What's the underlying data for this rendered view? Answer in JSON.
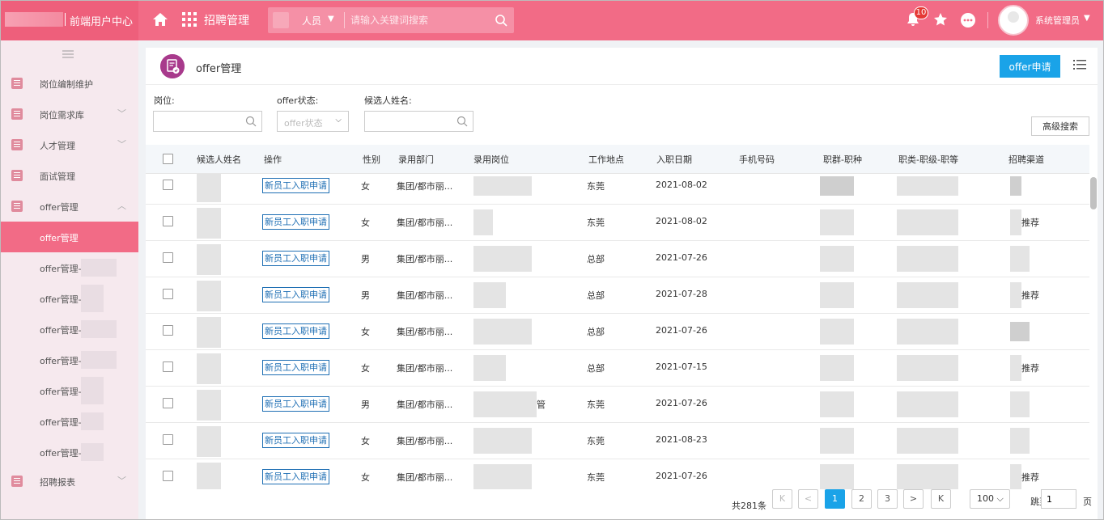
{
  "topbar": {
    "app_name": "前端用户中心",
    "module_title": "招聘管理",
    "search_category": "人员",
    "search_placeholder": "请输入关键词搜索",
    "notification_count": "10",
    "user_name": "系统管理员",
    "accent_color": "#f26b86"
  },
  "sidebar": {
    "items": [
      {
        "label": "岗位编制维护",
        "icon": "document-icon"
      },
      {
        "label": "岗位需求库",
        "icon": "document-icon"
      },
      {
        "label": "人才管理",
        "icon": "document-icon"
      },
      {
        "label": "面试管理",
        "icon": "document-icon"
      },
      {
        "label": "offer管理",
        "icon": "document-icon"
      }
    ],
    "sub_items": [
      "offer管理",
      "offer管理-",
      "offer管理-",
      "offer管理-",
      "offer管理-",
      "offer管理-",
      "offer管理-",
      "offer管理-"
    ],
    "last_item": {
      "label": "招聘报表",
      "icon": "document-icon"
    }
  },
  "page": {
    "title": "offer管理",
    "apply_button": "offer申请"
  },
  "filters": {
    "position_label": "岗位:",
    "status_label": "offer状态:",
    "status_placeholder": "offer状态",
    "candidate_label": "候选人姓名:",
    "advanced_search": "高级搜索"
  },
  "table": {
    "headers": [
      "候选人姓名",
      "操作",
      "性别",
      "录用部门",
      "录用岗位",
      "工作地点",
      "入职日期",
      "手机号码",
      "职群-职种",
      "职类-职级-职等",
      "招聘渠道"
    ],
    "action_label": "新员工入职申请",
    "rows": [
      {
        "gender": "女",
        "dept": "集团/都市丽...",
        "location": "东莞",
        "date": "2021-08-02",
        "channel": "",
        "post_suffix": ""
      },
      {
        "gender": "女",
        "dept": "集团/都市丽...",
        "location": "东莞",
        "date": "2021-08-02",
        "channel": "推荐",
        "post_suffix": ""
      },
      {
        "gender": "男",
        "dept": "集团/都市丽...",
        "location": "总部",
        "date": "2021-07-26",
        "channel": "",
        "post_suffix": ""
      },
      {
        "gender": "男",
        "dept": "集团/都市丽...",
        "location": "总部",
        "date": "2021-07-28",
        "channel": "推荐",
        "post_suffix": ""
      },
      {
        "gender": "女",
        "dept": "集团/都市丽...",
        "location": "总部",
        "date": "2021-07-26",
        "channel": "",
        "post_suffix": ""
      },
      {
        "gender": "女",
        "dept": "集团/都市丽...",
        "location": "总部",
        "date": "2021-07-15",
        "channel": "推荐",
        "post_suffix": ""
      },
      {
        "gender": "男",
        "dept": "集团/都市丽...",
        "location": "东莞",
        "date": "2021-07-26",
        "channel": "",
        "post_suffix": "管"
      },
      {
        "gender": "女",
        "dept": "集团/都市丽...",
        "location": "东莞",
        "date": "2021-08-23",
        "channel": "",
        "post_suffix": ""
      },
      {
        "gender": "女",
        "dept": "集团/都市丽...",
        "location": "东莞",
        "date": "2021-07-26",
        "channel": "推荐",
        "post_suffix": ""
      }
    ]
  },
  "pagination": {
    "total": "共281条",
    "first": "K",
    "prev": "<",
    "pages": [
      "1",
      "2",
      "3"
    ],
    "next": ">",
    "last": "K",
    "page_size": "100",
    "jump_label": "跳至",
    "jump_value": "1",
    "page_unit": "页"
  }
}
